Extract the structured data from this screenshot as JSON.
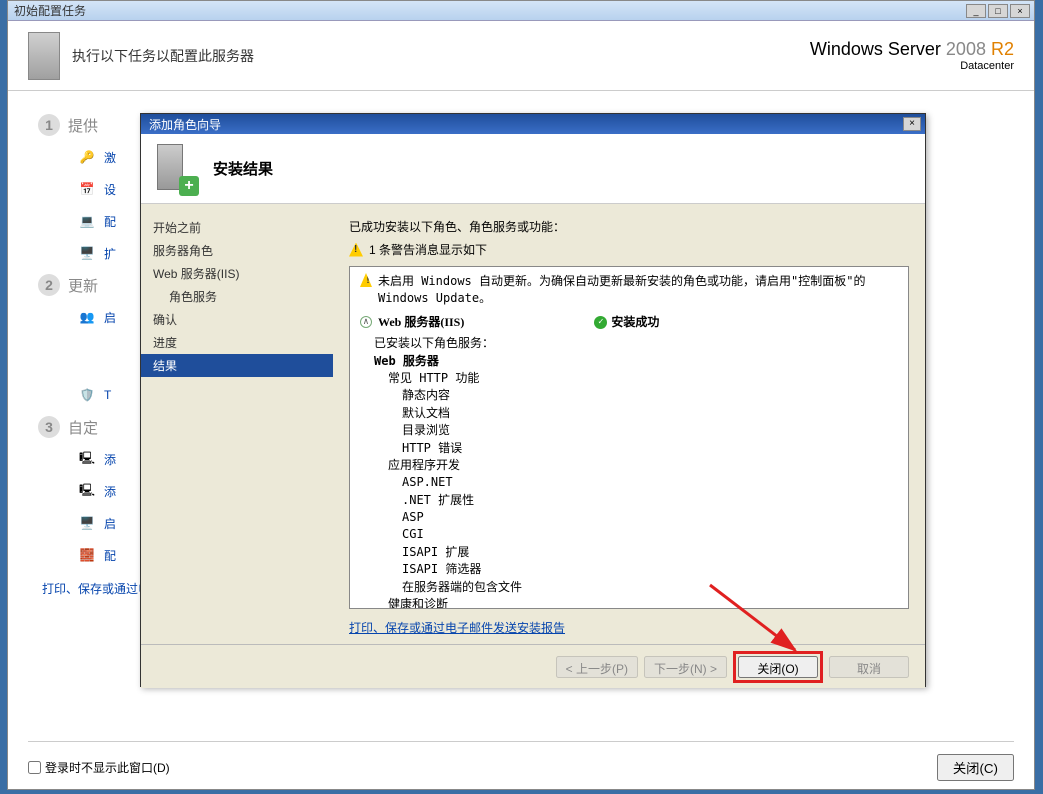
{
  "outer": {
    "title": "初始配置任务",
    "header_text": "执行以下任务以配置此服务器",
    "brand_line1": "Windows Server 2008 R2",
    "brand_line2": "Datacenter",
    "steps": {
      "s1": "提供",
      "s2": "更新",
      "s3": "自定"
    },
    "bg_items": {
      "i1": "激",
      "i2": "设",
      "i3": "配",
      "i4": "扩",
      "i5": "启",
      "i6": "T",
      "i7": "添",
      "i8": "添",
      "i9": "启",
      "i10": "配"
    },
    "footer_link": "打印、保存或通过电子邮件发送此信息(S)",
    "checkbox_label": "登录时不显示此窗口(D)",
    "close_btn": "关闭(C)"
  },
  "dialog": {
    "title": "添加角色向导",
    "heading": "安装结果",
    "nav": {
      "n0": "开始之前",
      "n1": "服务器角色",
      "n2": "Web 服务器(IIS)",
      "n3": "角色服务",
      "n4": "确认",
      "n5": "进度",
      "n6": "结果"
    },
    "intro": "已成功安装以下角色、角色服务或功能：",
    "warn_summary": "1 条警告消息显示如下",
    "warn_detail": "未启用 Windows 自动更新。为确保自动更新最新安装的角色或功能，请启用\"控制面板\"的 Windows Update。",
    "role_name": "Web 服务器(IIS)",
    "status_text": "安装成功",
    "tree": {
      "installed_label": "已安装以下角色服务：",
      "web_server": "Web 服务器",
      "http_common": "常见 HTTP 功能",
      "static": "静态内容",
      "default_doc": "默认文档",
      "dir_browse": "目录浏览",
      "http_err": "HTTP 错误",
      "app_dev": "应用程序开发",
      "aspnet": "ASP.NET",
      "net_ext": ".NET 扩展性",
      "asp": "ASP",
      "cgi": "CGI",
      "isapi_ext": "ISAPI 扩展",
      "isapi_filt": "ISAPI 筛选器",
      "ssi": "在服务器端的包含文件",
      "health": "健康和诊断"
    },
    "report_link": "打印、保存或通过电子邮件发送安装报告",
    "buttons": {
      "prev": "< 上一步(P)",
      "next": "下一步(N) >",
      "close": "关闭(O)",
      "cancel": "取消"
    }
  }
}
